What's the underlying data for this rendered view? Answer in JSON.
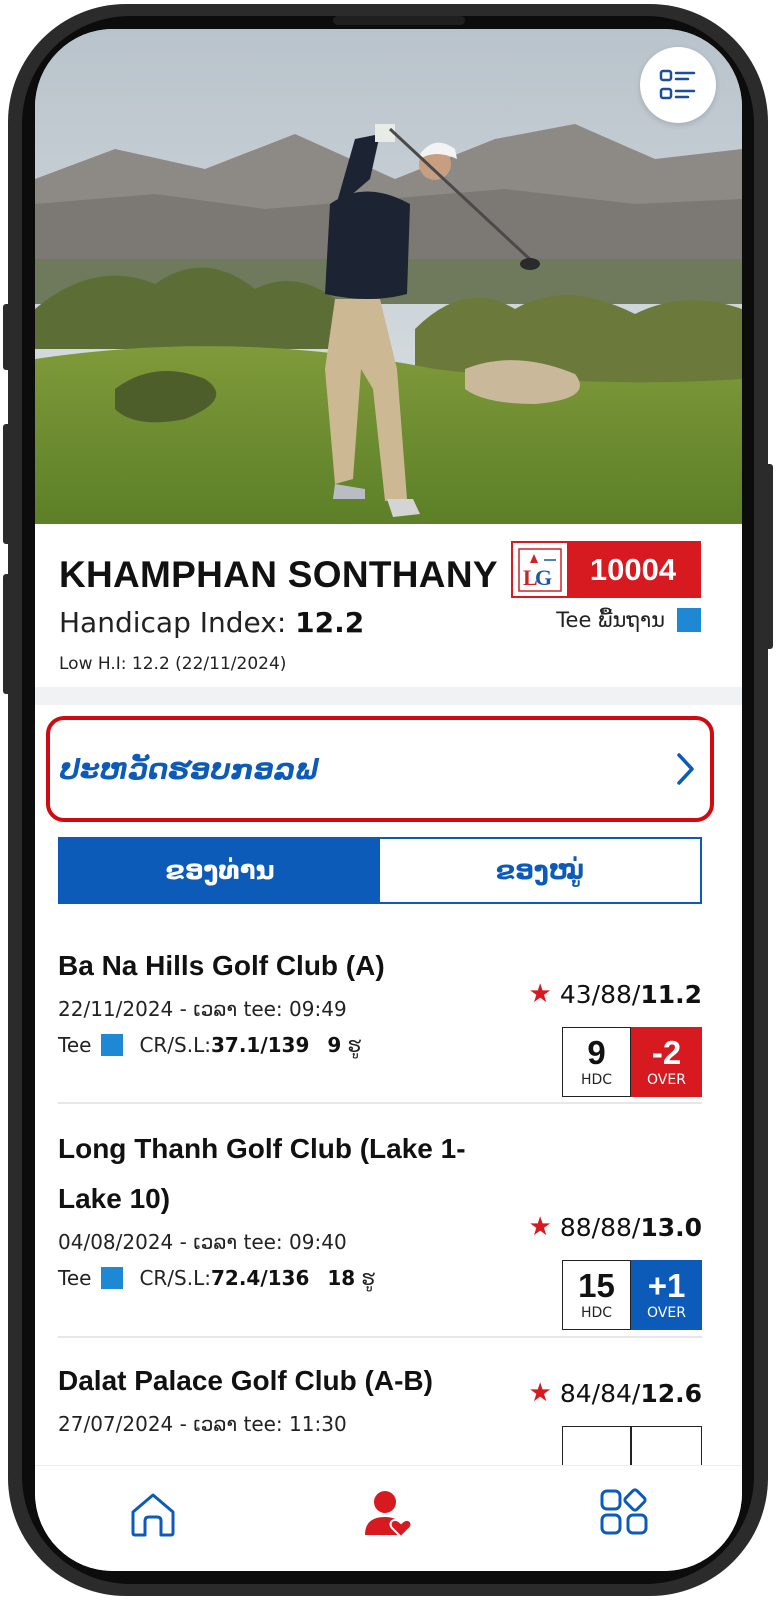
{
  "profile": {
    "name": "KHAMPHAN SONTHANY",
    "handicap_label": "Handicap Index: ",
    "handicap_value": "12.2",
    "low_hi": "Low H.I: 12.2 (22/11/2024)",
    "member_number": "10004",
    "tee_label": "Tee ພື້ນຖານ",
    "tee_color": "#1e88d4"
  },
  "history": {
    "title": "ປະຫວັດຮອບກອລຟ"
  },
  "tabs": [
    {
      "label": "ຂອງທ່ານ",
      "active": true
    },
    {
      "label": "ຂອງໝູ່",
      "active": false
    }
  ],
  "rounds": [
    {
      "club": "Ba Na Hills Golf Club (A)",
      "date_time": "22/11/2024 - ເວລາ tee: 09:49",
      "tee": "Tee",
      "crsl_label": "CR/S.L: ",
      "crsl_value": "37.1/139",
      "holes_num": "9",
      "holes_unit": "ຮູ",
      "score_prefix": "43/88/",
      "score_bold": "11.2",
      "hdc": "9",
      "hdc_label": "HDC",
      "over": "-2",
      "over_label": "OVER",
      "over_color": "#d71920"
    },
    {
      "club": "Long Thanh Golf Club (Lake 1-Lake 10)",
      "date_time": "04/08/2024 - ເວລາ tee: 09:40",
      "tee": "Tee",
      "crsl_label": "CR/S.L: ",
      "crsl_value": "72.4/136",
      "holes_num": "18",
      "holes_unit": "ຮູ",
      "score_prefix": "88/88/",
      "score_bold": "13.0",
      "hdc": "15",
      "hdc_label": "HDC",
      "over": "+1",
      "over_label": "OVER",
      "over_color": "#0c5bb8"
    },
    {
      "club": "Dalat Palace Golf Club (A-B)",
      "date_time": "27/07/2024 - ເວລາ tee: 11:30",
      "score_prefix": "84/84/",
      "score_bold": "12.6"
    }
  ],
  "nav": {
    "items": [
      "home-icon",
      "profile-heart-icon",
      "apps-icon"
    ],
    "accent": "#0c5bb8",
    "active_color": "#d71920"
  }
}
